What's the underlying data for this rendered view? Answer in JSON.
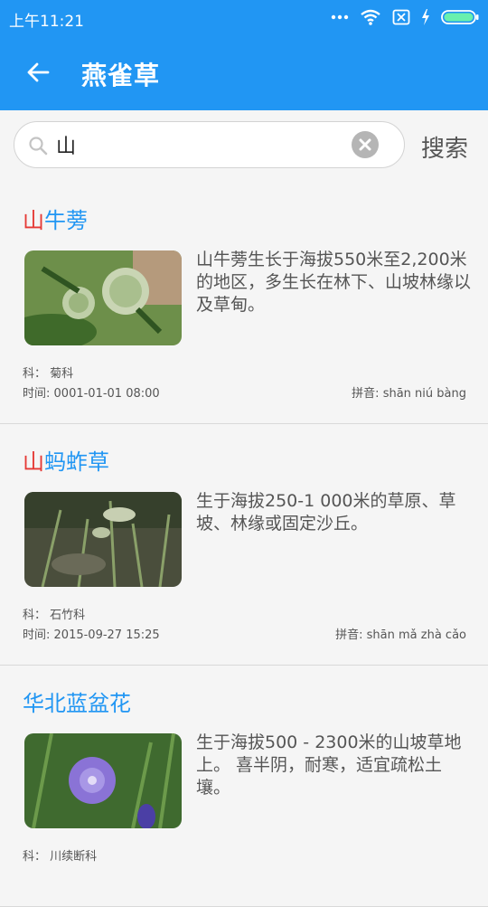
{
  "status_bar": {
    "time": "上午11:21"
  },
  "app_bar": {
    "title": "燕雀草"
  },
  "search": {
    "query": "山",
    "button_label": "搜索"
  },
  "labels": {
    "family": "科：",
    "time": "时间:",
    "pinyin": "拼音:"
  },
  "results": [
    {
      "title_highlight": "山",
      "title_rest": "牛蒡",
      "description": "山牛蒡生长于海拔550米至2,200米的地区，多生长在林下、山坡林缘以及草甸。",
      "family": "菊科",
      "time": "0001-01-01 08:00",
      "pinyin": "shān niú bàng"
    },
    {
      "title_highlight": "山",
      "title_rest": "蚂蚱草",
      "description": "生于海拔250-1 000米的草原、草坡、林缘或固定沙丘。",
      "family": "石竹科",
      "time": "2015-09-27 15:25",
      "pinyin": "shān mǎ zhà cǎo"
    },
    {
      "title_highlight": "",
      "title_rest": "华北蓝盆花",
      "description": "生于海拔500 - 2300米的山坡草地上。 喜半阴，耐寒，适宜疏松土壤。",
      "family": "川续断科",
      "time": "",
      "pinyin": ""
    }
  ]
}
